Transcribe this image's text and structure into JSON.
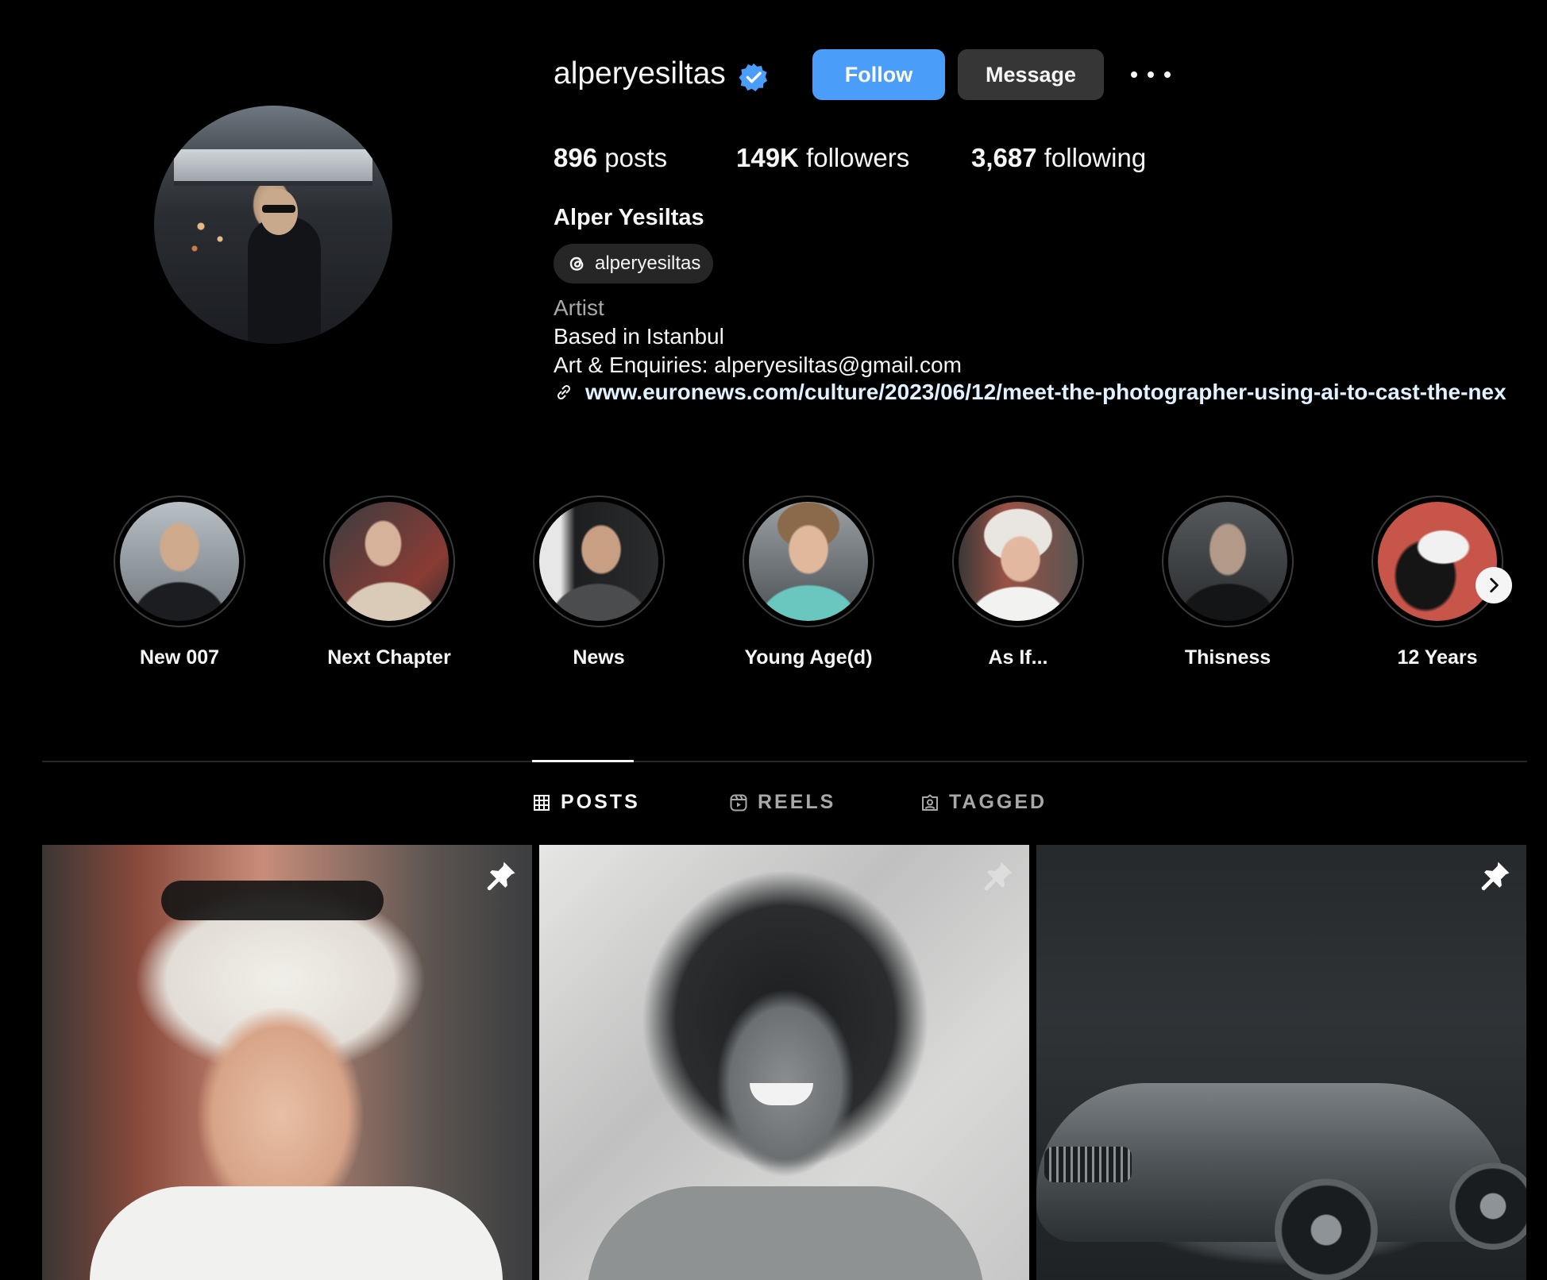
{
  "profile": {
    "username": "alperyesiltas",
    "verified": true,
    "follow_label": "Follow",
    "message_label": "Message",
    "stats": {
      "posts_count": "896",
      "posts_label": "posts",
      "followers_count": "149K",
      "followers_label": "followers",
      "following_count": "3,687",
      "following_label": "following"
    },
    "full_name": "Alper Yesiltas",
    "threads_handle": "alperyesiltas",
    "bio": {
      "category": "Artist",
      "line1": "Based in Istanbul",
      "line2": "Art & Enquiries: alperyesiltas@gmail.com",
      "link": "www.euronews.com/culture/2023/06/12/meet-the-photographer-using-ai-to-cast-the-nex"
    }
  },
  "highlights": [
    {
      "label": "New 007"
    },
    {
      "label": "Next Chapter"
    },
    {
      "label": "News"
    },
    {
      "label": "Young Age(d)"
    },
    {
      "label": "As If..."
    },
    {
      "label": "Thisness"
    },
    {
      "label": "12 Years"
    }
  ],
  "tabs": {
    "posts": "POSTS",
    "reels": "REELS",
    "tagged": "TAGGED",
    "active": "posts"
  },
  "posts": [
    {
      "pinned": true
    },
    {
      "pinned": true
    },
    {
      "pinned": true
    }
  ],
  "colors": {
    "background": "#000000",
    "primary_button": "#4a9df8",
    "secondary_button": "#363636",
    "verified_badge": "#4a9df8",
    "muted_text": "#a8a8a8"
  },
  "icons": {
    "verified": "verified-badge-icon",
    "more": "more-options-icon",
    "threads": "threads-icon",
    "link": "link-icon",
    "next": "chevron-right-icon",
    "posts_tab": "grid-icon",
    "reels_tab": "reels-icon",
    "tagged_tab": "tagged-user-icon",
    "pin": "pin-icon"
  }
}
